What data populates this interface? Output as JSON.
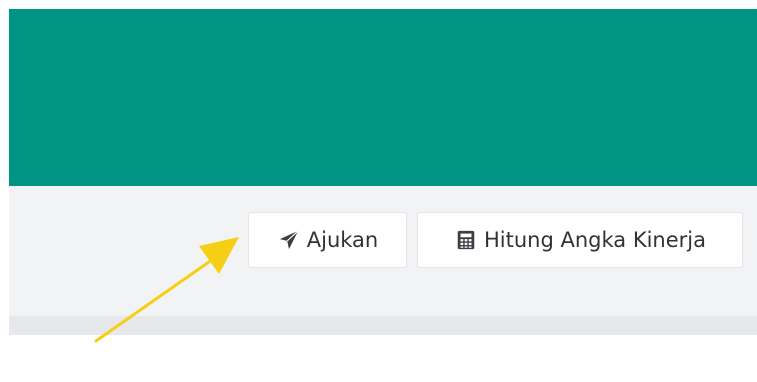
{
  "toolbar": {
    "buttons": [
      {
        "label": "Ajukan",
        "icon": "paper-plane-icon"
      },
      {
        "label": "Hitung Angka Kinerja",
        "icon": "calculator-icon"
      }
    ]
  },
  "colors": {
    "header": "#009485",
    "toolbar": "#f2f3f5",
    "button_bg": "#ffffff",
    "button_border": "#e3e5e8",
    "text": "#2f3338",
    "annotation": "#f5cf16"
  }
}
